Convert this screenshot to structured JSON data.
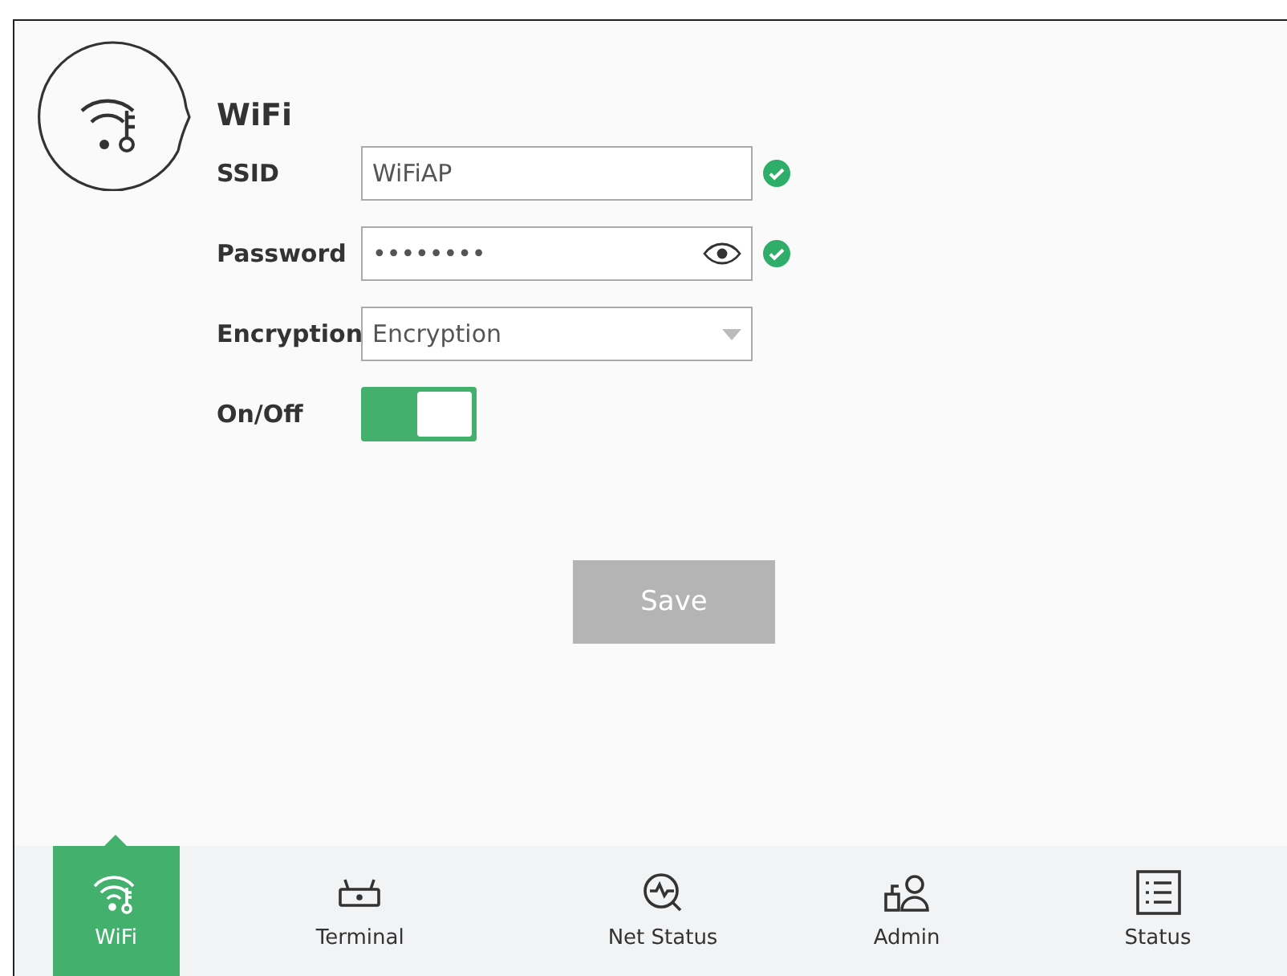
{
  "section": {
    "title": "WiFi"
  },
  "fields": [
    {
      "kind": "text",
      "label": "SSID",
      "value": "WiFiAP",
      "valid": true
    },
    {
      "kind": "password",
      "label": "Password",
      "value": "••••••••",
      "valid": true
    },
    {
      "kind": "select",
      "label": "Encryption",
      "value": "Encryption"
    },
    {
      "kind": "toggle",
      "label": "On/Off",
      "on": true
    }
  ],
  "save_button": {
    "label": "Save",
    "disabled": true
  },
  "nav": [
    {
      "label": "WiFi",
      "kind": "wifi",
      "selected": true
    },
    {
      "label": "Terminal",
      "kind": "router",
      "selected": false
    },
    {
      "label": "Net Status",
      "kind": "pulse",
      "selected": false
    },
    {
      "label": "Admin",
      "kind": "admin",
      "selected": false
    },
    {
      "label": "Status",
      "kind": "list",
      "selected": false
    }
  ]
}
